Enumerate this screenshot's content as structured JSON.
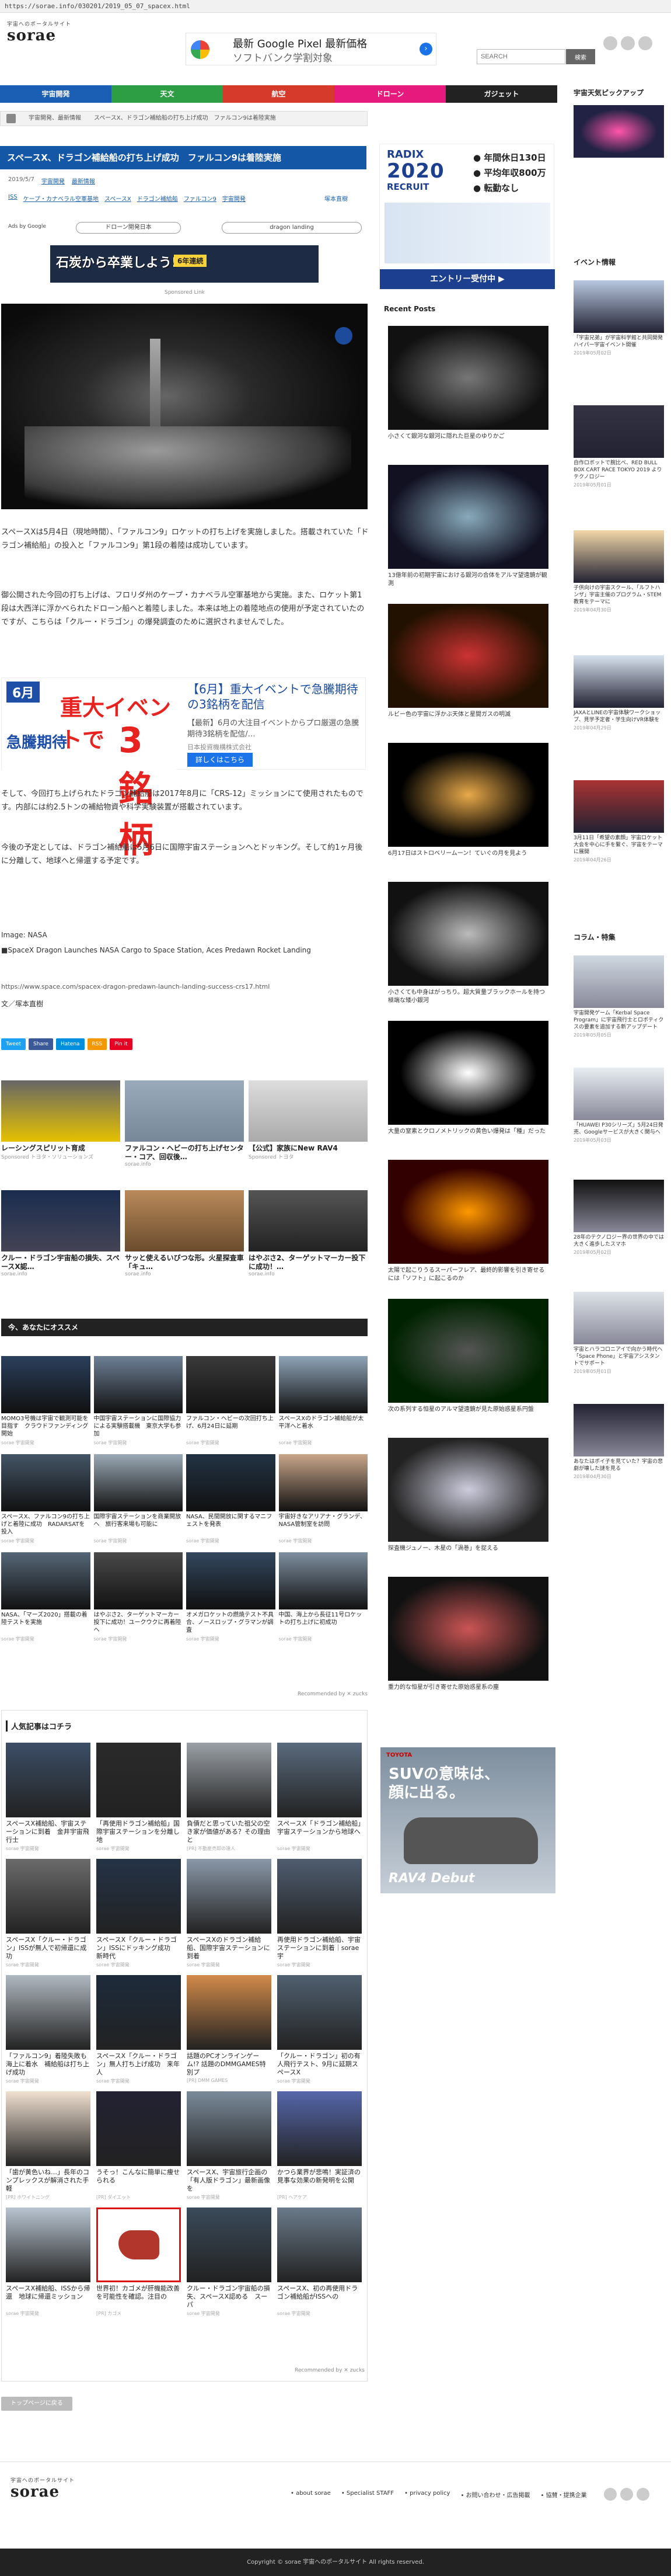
{
  "url": "https://sorae.info/030201/2019_05_07_spacex.html",
  "logo": {
    "tag": "宇宙へのポータルサイト",
    "word": "sorae"
  },
  "header_ad": {
    "line1": "最新 Google Pixel 最新価格",
    "line2": "ソフトバンク学割対象"
  },
  "search": {
    "placeholder": "SEARCH",
    "button": "検索"
  },
  "nav": [
    {
      "label": "宇宙開発",
      "color": "#1a5fb4"
    },
    {
      "label": "天文",
      "color": "#2e9e44"
    },
    {
      "label": "航空",
      "color": "#d63a2a"
    },
    {
      "label": "ドローン",
      "color": "#e6197d"
    },
    {
      "label": "ガジェット",
      "color": "#222222"
    }
  ],
  "sidebar_top_title": "宇宙天気ピックアップ",
  "breadcrumb": [
    "宇宙開発、最新情報",
    "スペースX、ドラゴン補給船の打ち上げ成功　ファルコン9は着陸実施"
  ],
  "article": {
    "title": "スペースX、ドラゴン補給船の打ち上げ成功　ファルコン9は着陸実施",
    "date": "2019/5/7",
    "cat1": "宇宙開発",
    "cat2": "最新情報",
    "tags": [
      "ISS",
      "ケープ・カナベラル空軍基地",
      "スペースX",
      "ドラゴン補給船",
      "ファルコン9",
      "宇宙開発"
    ],
    "author": "塚本直樹",
    "ads_by": "Ads by Google",
    "pill1": "ドローン開発日本",
    "pill2": "dragon landing",
    "banner_text": "石炭から卒業しよう!",
    "banner_badge": "6年連続",
    "sponsored": "Sponsored Link",
    "p1": "スペースXは5月4日（現地時間）、「ファルコン9」ロケットの打ち上げを実施しました。搭載されていた「ドラゴン補給船」の投入と「ファルコン9」第1段の着陸は成功しています。",
    "p2": "御公開された今回の打ち上げは、フロリダ州のケープ・カナベラル空軍基地から実施。また、ロケット第1段は大西洋に浮かべられたドローン船へと着陸しました。本来は地上の着陸地点の使用が予定されていたのですが、こちらは「クルー・ドラゴン」の爆発調査のために選択されませんでした。",
    "p3": "そして、今回打ち上げられたドラゴン補給船は2017年8月に「CRS-12」ミッションにて使用されたものです。内部には約2.5トンの補給物資や科学実験装置が搭載されています。",
    "p4": "今後の予定としては、ドラゴン補給船は5月6日に国際宇宙ステーションへとドッキング。そして約1ヶ月後に分離して、地球へと帰還する予定です。",
    "image_credit": "Image: NASA",
    "source_title": "■SpaceX Dragon Launches NASA Cargo to Space Station, Aces Predawn Rocket Landing",
    "source_url": "https://www.space.com/spacex-dragon-predawn-launch-landing-success-crs17.html",
    "by": "文／塚本直樹"
  },
  "inline_ad": {
    "month": "6月",
    "big": "重大イベントで",
    "sub": "急騰期待",
    "three": "3銘柄",
    "r1": "【6月】重大イベントで急騰期待の3銘柄を配信",
    "r2": "【最新】6月の大注目イベントからプロ厳選の急騰期待3銘柄を配信/…",
    "r3": "日本投資機構株式会社",
    "btn": "詳しくはこちら"
  },
  "share": [
    {
      "label": "Tweet",
      "color": "#1da1f2"
    },
    {
      "label": "Share",
      "color": "#3b5998"
    },
    {
      "label": "Hatena",
      "color": "#008fde"
    },
    {
      "label": "RSS",
      "color": "#f39800"
    },
    {
      "label": "Pin it",
      "color": "#e60023"
    }
  ],
  "reco_top": [
    {
      "title": "レーシングスピリット育成",
      "src": "Sponsored トヨタ・ソリューションズ"
    },
    {
      "title": "ファルコン・ヘビーの打ち上げセンター・コア、回収後…",
      "src": "sorae.info"
    },
    {
      "title": "【公式】家族にNew RAV4",
      "src": "Sponsored トヨタ"
    }
  ],
  "reco_mid": [
    {
      "title": "クルー・ドラゴン宇宙船の損失、スペースX認…",
      "src": "sorae.info"
    },
    {
      "title": "サッと使えるいびつな形。火星探査車「キュ…",
      "src": "sorae.info"
    },
    {
      "title": "はやぶさ2、ターゲットマーカー投下に成功！…",
      "src": "sorae.info"
    }
  ],
  "recommend_title": "今、あなたにオススメ",
  "rec_grid": [
    {
      "cap": "MOMO3号機は宇宙で観測可能を目指す　クラウドファンディング開始",
      "src": "sorae 宇宙開発"
    },
    {
      "cap": "中国宇宙ステーションに国際協力による実験搭載機　東京大学も参加",
      "src": "sorae 宇宙開発"
    },
    {
      "cap": "ファルコン・ヘビーの次回打ち上げ、6月24日に延期",
      "src": "sorae 宇宙開発"
    },
    {
      "cap": "スペースXのドラゴン補給船が太平洋へと着水",
      "src": "sorae 宇宙開発"
    },
    {
      "cap": "スペースX、ファルコン9の打ち上げと着陸に成功　RADARSATを投入",
      "src": "sorae 宇宙開発"
    },
    {
      "cap": "国際宇宙ステーションを商業開放へ　旅行客来場も可能に",
      "src": "sorae 宇宙開発"
    },
    {
      "cap": "NASA、民間開放に関するマニフェストを発表",
      "src": "sorae 宇宙開発"
    },
    {
      "cap": "宇宙好きなアリアナ・グランデ、NASA管制室を訪問",
      "src": "sorae 宇宙開発"
    },
    {
      "cap": "NASA、「マーズ2020」搭載の着陸テストを実施",
      "src": "sorae 宇宙開発"
    },
    {
      "cap": "はやぶさ2、ターゲットマーカー投下に成功！ユークウクに再着陸へ",
      "src": "sorae 宇宙開発"
    },
    {
      "cap": "オメガロケットの燃焼テスト不具合、ノースロップ・グラマンが調査",
      "src": "sorae 宇宙開発"
    },
    {
      "cap": "中国、海上から長征11号ロケットの打ち上げに初成功",
      "src": "sorae 宇宙開発"
    }
  ],
  "recommended_by": "Recommended by ✕ zucks",
  "popular_title": "人気記事はコチラ",
  "popular": [
    {
      "cap": "スペースX補給船、宇宙ステーションに到着　金井宇宙飛行士",
      "src": "sorae 宇宙開発"
    },
    {
      "cap": "「再使用ドラゴン補給船」国際宇宙ステーションを分離し地",
      "src": "sorae 宇宙開発"
    },
    {
      "cap": "負債だと思っていた祖父の空き家が価値がある？その理由と",
      "src": "[PR] 不動産売却の達人"
    },
    {
      "cap": "スペースX「ドラゴン補給船」宇宙ステーションから地球へ",
      "src": "sorae 宇宙開発"
    },
    {
      "cap": "スペースX「クルー・ドラゴン」ISSが無人で初帰還に成功",
      "src": "sorae 宇宙開発"
    },
    {
      "cap": "スペースX「クルー・ドラゴン」ISSにドッキング成功　新時代",
      "src": "sorae 宇宙開発"
    },
    {
      "cap": "スペースXのドラゴン補給船、国際宇宙ステーションに到着",
      "src": "sorae 宇宙開発"
    },
    {
      "cap": "再使用ドラゴン補給船、宇宙ステーションに到着｜sorae 宇",
      "src": "sorae 宇宙開発"
    },
    {
      "cap": "「ファルコン9」着陸失敗も海上に着水　補給船は打ち上げ成功",
      "src": "sorae 宇宙開発"
    },
    {
      "cap": "スペースX「クルー・ドラゴン」無人打ち上げ成功　来年人",
      "src": "sorae 宇宙開発"
    },
    {
      "cap": "話題のPCオンラインゲーム!? 話題のDMMGAMES特別プ",
      "src": "[PR] DMM GAMES"
    },
    {
      "cap": "「クルー・ドラゴン」初の有人飛行テスト、9月に延期スペースX",
      "src": "sorae 宇宙開発"
    },
    {
      "cap": "「歯が黄色いね…」長年のコンプレックスが解消された手軽",
      "src": "[PR] ホワイトニング"
    },
    {
      "cap": "うそっ！こんなに簡単に痩せられる",
      "src": "[PR] ダイエット"
    },
    {
      "cap": "スペースX、宇宙旅行企画の「有人版ドラゴン」最新画像を",
      "src": "sorae 宇宙開発"
    },
    {
      "cap": "かつら業界が悲鳴！実証済の見事な効果の新発明を公開",
      "src": "[PR] ヘアケア"
    },
    {
      "cap": "スペースX補給船、ISSから帰還　地球に帰還ミッション",
      "src": "sorae 宇宙開発"
    },
    {
      "cap": "世界初！カゴメが肝機能改善を可能性を確認。注目の",
      "src": "[PR] カゴメ"
    },
    {
      "cap": "クルー・ドラゴン宇宙船の損失、スペースX認める　スーパ",
      "src": "sorae 宇宙開発"
    },
    {
      "cap": "スペースX、初の再使用ドラゴン補給船がISSへの",
      "src": "sorae 宇宙開発"
    }
  ],
  "toppage": "トップページに戻る",
  "radix": {
    "r": "RADIX",
    "yr": "2020",
    "rec": "RECRUIT",
    "p1": "● 年間休日130日",
    "p2": "● 平均年収800万",
    "p3": "● 転勤なし",
    "entry": "エントリー受付中 ▶"
  },
  "recent_title": "Recent Posts",
  "recent": [
    "小さくて銀河な銀河に隠れた巨星のゆりかご",
    "13億年前の初期宇宙における銀河の合体をアルマ望遠鏡が観測",
    "ルビー色の宇宙に浮かぶ天体と星間ガスの明滅",
    "6月17日はストロベリームーン！ていぐの月を見よう",
    "小さくても中身はがっちり。超大質量ブラックホールを持つ極端な矮小銀河",
    "大量の窒素とクロノメトリックの黄色い爆発は「種」だった",
    "太陽で起こりうるスーパーフレア、最終的影響を引き寄せるには「ソフト」に起こるのか",
    "次の系列する恒星のアルマ望遠鏡が見た原始惑星系円盤",
    "探査機ジュノー、木星の「渦巻」を捉える",
    "重力的な恒星が引き寄せた原始惑星系の塵"
  ],
  "event_title": "イベント情報",
  "events": [
    {
      "cap": "「宇宙兄弟」が宇宙科学館と共同開発　ハイパー宇宙イベント開催",
      "date": "2019年05月02日"
    },
    {
      "cap": "自作ロボットで腕比べ、RED BULL BOX CART RACE TOKYO 2019 よりテクノロジー",
      "date": "2019年05月01日"
    },
    {
      "cap": "子供向けの宇宙スクール、「ルフトハンザ」宇宙主催のプログラム・STEM教育をテーマに",
      "date": "2019年04月30日"
    },
    {
      "cap": "JAXAとLINEの宇宙体験ワークショップ、見学予定者・学生向けVR体験を",
      "date": "2019年04月29日"
    },
    {
      "cap": "3月11日「希望の素顔」宇宙ロケット大会を中心に手を繋ぐ、宇宙をテーマに展開",
      "date": "2019年04月26日"
    }
  ],
  "column_title": "コラム・特集",
  "columns": [
    {
      "cap": "宇宙開発ゲーム「Kerbal Space Program」に宇宙飛行士とロボティクスの要素を追加する新アップデート",
      "date": "2019年05月05日"
    },
    {
      "cap": "「HUAWEI P30シリーズ」5月24日発売、Googleサービスが大きく関与へ",
      "date": "2019年05月03日"
    },
    {
      "cap": "28年のテクノロジー界の世界の中では大きく進歩したスマホ",
      "date": "2019年05月02日"
    },
    {
      "cap": "宇宙とハラコロニアイで向かう時代へ「Space Phone」と宇宙アシスタントでサポート",
      "date": "2019年05月01日"
    },
    {
      "cap": "あなたはポイ子を見ていた？宇宙の悲劇が壊した謎を見る",
      "date": "2019年04月30日"
    }
  ],
  "rav_ad": {
    "brand": "TOYOTA",
    "h1": "SUVの意味は、",
    "h2": "顔に出る。",
    "name": "RAV4 Debut"
  },
  "footer": {
    "links": [
      "• about sorae",
      "• Specialist STAFF",
      "• privacy policy",
      "• お問い合わせ・広告掲載",
      "• 協賛・提携企業"
    ],
    "copyright": "Copyright © sorae 宇宙へのポータルサイト All rights reserved."
  }
}
